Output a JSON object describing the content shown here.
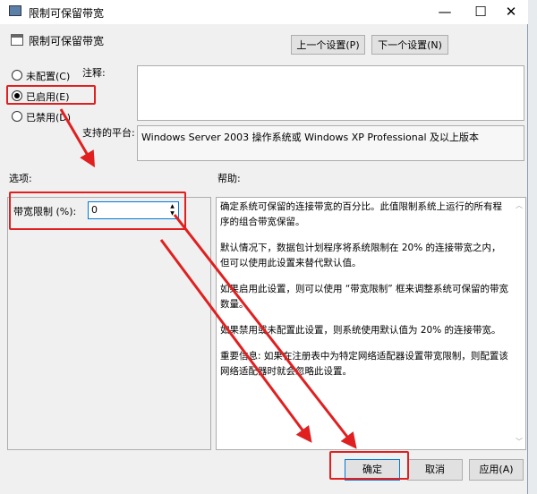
{
  "window": {
    "title": "限制可保留带宽",
    "minimize": "—",
    "maximize": "☐",
    "close": "✕"
  },
  "header": {
    "title": "限制可保留带宽",
    "prev_button": "上一个设置(P)",
    "next_button": "下一个设置(N)"
  },
  "state": {
    "options": [
      {
        "label": "未配置(C)",
        "selected": false
      },
      {
        "label": "已启用(E)",
        "selected": true
      },
      {
        "label": "已禁用(D)",
        "selected": false
      }
    ]
  },
  "comment": {
    "label": "注释:",
    "value": ""
  },
  "platform": {
    "label": "支持的平台:",
    "value": "Windows Server 2003 操作系统或 Windows XP Professional 及以上版本"
  },
  "options_section": {
    "label": "选项:",
    "bandwidth_label": "带宽限制 (%):",
    "bandwidth_value": "0"
  },
  "help_section": {
    "label": "帮助:",
    "paragraphs": [
      "确定系统可保留的连接带宽的百分比。此值限制系统上运行的所有程序的组合带宽保留。",
      "默认情况下，数据包计划程序将系统限制在 20% 的连接带宽之内，但可以使用此设置来替代默认值。",
      "如果启用此设置，则可以使用 “带宽限制” 框来调整系统可保留的带宽数量。",
      "如果禁用或未配置此设置，则系统使用默认值为 20% 的连接带宽。",
      "重要信息: 如果在注册表中为特定网络适配器设置带宽限制，则配置该网络适配器时就会忽略此设置。"
    ]
  },
  "footer": {
    "ok": "确定",
    "cancel": "取消",
    "apply": "应用(A)"
  },
  "colors": {
    "annotation": "#e02020",
    "focus": "#0078d7"
  }
}
